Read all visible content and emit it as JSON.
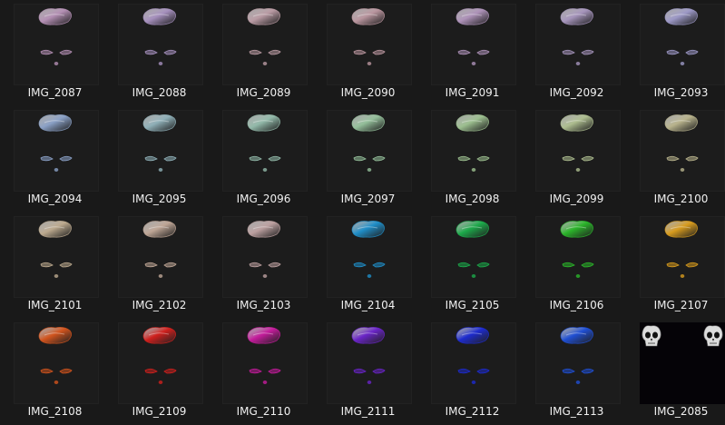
{
  "files": [
    {
      "name": "IMG_2087",
      "color": "#b48fb4",
      "variant": "face"
    },
    {
      "name": "IMG_2088",
      "color": "#a58fbd",
      "variant": "face"
    },
    {
      "name": "IMG_2089",
      "color": "#b99aa3",
      "variant": "face"
    },
    {
      "name": "IMG_2090",
      "color": "#b9959e",
      "variant": "face"
    },
    {
      "name": "IMG_2091",
      "color": "#ad91b8",
      "variant": "face"
    },
    {
      "name": "IMG_2092",
      "color": "#a594bb",
      "variant": "face"
    },
    {
      "name": "IMG_2093",
      "color": "#9c98c6",
      "variant": "face"
    },
    {
      "name": "IMG_2094",
      "color": "#8aa0c6",
      "variant": "face"
    },
    {
      "name": "IMG_2095",
      "color": "#8fb0b8",
      "variant": "face"
    },
    {
      "name": "IMG_2096",
      "color": "#92b9a9",
      "variant": "face"
    },
    {
      "name": "IMG_2097",
      "color": "#94bf9a",
      "variant": "face"
    },
    {
      "name": "IMG_2098",
      "color": "#9cbf8f",
      "variant": "face"
    },
    {
      "name": "IMG_2099",
      "color": "#adbd8f",
      "variant": "face"
    },
    {
      "name": "IMG_2100",
      "color": "#b8b38c",
      "variant": "face"
    },
    {
      "name": "IMG_2101",
      "color": "#bca98e",
      "variant": "face"
    },
    {
      "name": "IMG_2102",
      "color": "#bea595",
      "variant": "face"
    },
    {
      "name": "IMG_2103",
      "color": "#bb9f9f",
      "variant": "face"
    },
    {
      "name": "IMG_2104",
      "color": "#1f8ec8",
      "variant": "face"
    },
    {
      "name": "IMG_2105",
      "color": "#1ca94a",
      "variant": "face"
    },
    {
      "name": "IMG_2106",
      "color": "#2bb52a",
      "variant": "face"
    },
    {
      "name": "IMG_2107",
      "color": "#d79b1d",
      "variant": "face"
    },
    {
      "name": "IMG_2108",
      "color": "#d2541d",
      "variant": "face"
    },
    {
      "name": "IMG_2109",
      "color": "#d0201d",
      "variant": "face"
    },
    {
      "name": "IMG_2110",
      "color": "#c51b9c",
      "variant": "face"
    },
    {
      "name": "IMG_2111",
      "color": "#6a24c8",
      "variant": "face"
    },
    {
      "name": "IMG_2112",
      "color": "#1d2bd0",
      "variant": "face"
    },
    {
      "name": "IMG_2113",
      "color": "#1f4fd4",
      "variant": "face"
    },
    {
      "name": "IMG_2085",
      "color": "#c8c8c8",
      "variant": "skulls"
    }
  ]
}
